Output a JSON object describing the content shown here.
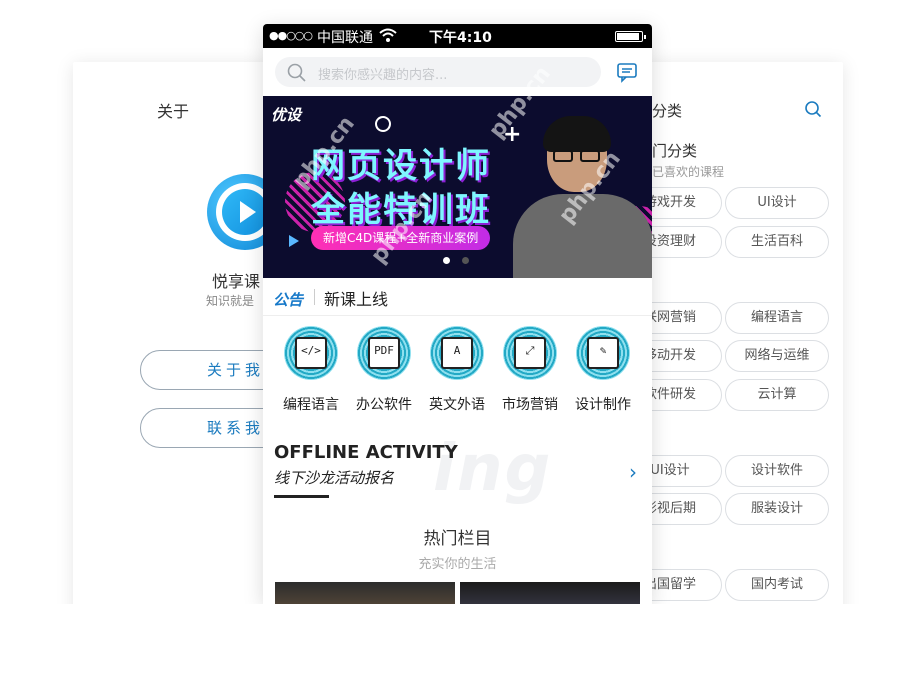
{
  "left_card": {
    "title": "关于",
    "app_name": "悦享课",
    "slogan": "知识就是",
    "buttons": [
      "关于我",
      "联系我"
    ]
  },
  "right_card": {
    "title": "分类",
    "section_title": "门分类",
    "section_desc": "已喜欢的课程",
    "tags": [
      "游戏开发",
      "UI设计",
      "投资理财",
      "生活百科",
      "联网营销",
      "编程语言",
      "移动开发",
      "网络与运维",
      "软件研发",
      "云计算",
      "UI设计",
      "设计软件",
      "影视后期",
      "服装设计",
      "出国留学",
      "国内考试"
    ]
  },
  "status_bar": {
    "signal": "●●○○○",
    "carrier": "中国联通",
    "time": "下午4:10"
  },
  "search": {
    "placeholder": "搜索你感兴趣的内容..."
  },
  "banner": {
    "brand": "优设",
    "title_line1": "网页设计师",
    "title_line2": "全能特训班",
    "pill": "新增C4D课程+全新商业案例",
    "active_dot": 0,
    "dot_count": 2,
    "colors": {
      "title": "#7ff6ff",
      "pill": "#ff2fb4",
      "bg": "#0c0c2e"
    }
  },
  "notice": {
    "tag": "公告",
    "text": "新课上线"
  },
  "categories": [
    {
      "label": "编程语言",
      "glyph": "</>"
    },
    {
      "label": "办公软件",
      "glyph": "PDF"
    },
    {
      "label": "英文外语",
      "glyph": "A"
    },
    {
      "label": "市场营销",
      "glyph": "⤢"
    },
    {
      "label": "设计制作",
      "glyph": "✎"
    }
  ],
  "offline": {
    "title_en": "OFFLINE ACTIVITY",
    "title_cn": "线下沙龙活动报名",
    "bg_word": "ing"
  },
  "hot": {
    "title": "热门栏目",
    "subtitle": "充实你的生活"
  },
  "watermark": "php.cn",
  "accent_color": "#1b7bbf"
}
